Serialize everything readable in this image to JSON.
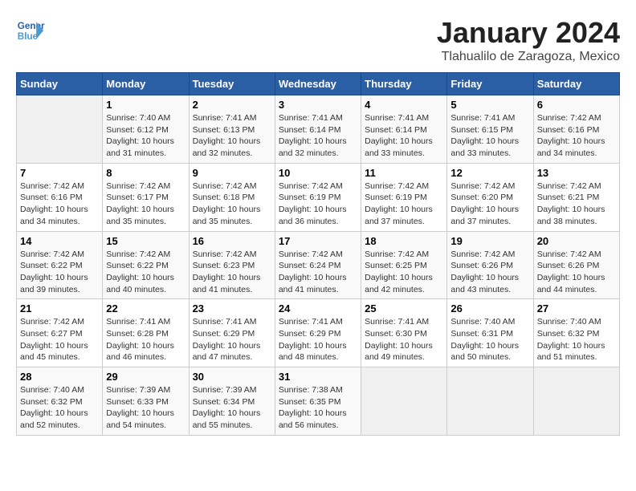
{
  "header": {
    "logo_line1": "General",
    "logo_line2": "Blue",
    "month_year": "January 2024",
    "location": "Tlahualilo de Zaragoza, Mexico"
  },
  "weekdays": [
    "Sunday",
    "Monday",
    "Tuesday",
    "Wednesday",
    "Thursday",
    "Friday",
    "Saturday"
  ],
  "weeks": [
    [
      {
        "day": "",
        "info": ""
      },
      {
        "day": "1",
        "info": "Sunrise: 7:40 AM\nSunset: 6:12 PM\nDaylight: 10 hours\nand 31 minutes."
      },
      {
        "day": "2",
        "info": "Sunrise: 7:41 AM\nSunset: 6:13 PM\nDaylight: 10 hours\nand 32 minutes."
      },
      {
        "day": "3",
        "info": "Sunrise: 7:41 AM\nSunset: 6:14 PM\nDaylight: 10 hours\nand 32 minutes."
      },
      {
        "day": "4",
        "info": "Sunrise: 7:41 AM\nSunset: 6:14 PM\nDaylight: 10 hours\nand 33 minutes."
      },
      {
        "day": "5",
        "info": "Sunrise: 7:41 AM\nSunset: 6:15 PM\nDaylight: 10 hours\nand 33 minutes."
      },
      {
        "day": "6",
        "info": "Sunrise: 7:42 AM\nSunset: 6:16 PM\nDaylight: 10 hours\nand 34 minutes."
      }
    ],
    [
      {
        "day": "7",
        "info": "Sunrise: 7:42 AM\nSunset: 6:16 PM\nDaylight: 10 hours\nand 34 minutes."
      },
      {
        "day": "8",
        "info": "Sunrise: 7:42 AM\nSunset: 6:17 PM\nDaylight: 10 hours\nand 35 minutes."
      },
      {
        "day": "9",
        "info": "Sunrise: 7:42 AM\nSunset: 6:18 PM\nDaylight: 10 hours\nand 35 minutes."
      },
      {
        "day": "10",
        "info": "Sunrise: 7:42 AM\nSunset: 6:19 PM\nDaylight: 10 hours\nand 36 minutes."
      },
      {
        "day": "11",
        "info": "Sunrise: 7:42 AM\nSunset: 6:19 PM\nDaylight: 10 hours\nand 37 minutes."
      },
      {
        "day": "12",
        "info": "Sunrise: 7:42 AM\nSunset: 6:20 PM\nDaylight: 10 hours\nand 37 minutes."
      },
      {
        "day": "13",
        "info": "Sunrise: 7:42 AM\nSunset: 6:21 PM\nDaylight: 10 hours\nand 38 minutes."
      }
    ],
    [
      {
        "day": "14",
        "info": "Sunrise: 7:42 AM\nSunset: 6:22 PM\nDaylight: 10 hours\nand 39 minutes."
      },
      {
        "day": "15",
        "info": "Sunrise: 7:42 AM\nSunset: 6:22 PM\nDaylight: 10 hours\nand 40 minutes."
      },
      {
        "day": "16",
        "info": "Sunrise: 7:42 AM\nSunset: 6:23 PM\nDaylight: 10 hours\nand 41 minutes."
      },
      {
        "day": "17",
        "info": "Sunrise: 7:42 AM\nSunset: 6:24 PM\nDaylight: 10 hours\nand 41 minutes."
      },
      {
        "day": "18",
        "info": "Sunrise: 7:42 AM\nSunset: 6:25 PM\nDaylight: 10 hours\nand 42 minutes."
      },
      {
        "day": "19",
        "info": "Sunrise: 7:42 AM\nSunset: 6:26 PM\nDaylight: 10 hours\nand 43 minutes."
      },
      {
        "day": "20",
        "info": "Sunrise: 7:42 AM\nSunset: 6:26 PM\nDaylight: 10 hours\nand 44 minutes."
      }
    ],
    [
      {
        "day": "21",
        "info": "Sunrise: 7:42 AM\nSunset: 6:27 PM\nDaylight: 10 hours\nand 45 minutes."
      },
      {
        "day": "22",
        "info": "Sunrise: 7:41 AM\nSunset: 6:28 PM\nDaylight: 10 hours\nand 46 minutes."
      },
      {
        "day": "23",
        "info": "Sunrise: 7:41 AM\nSunset: 6:29 PM\nDaylight: 10 hours\nand 47 minutes."
      },
      {
        "day": "24",
        "info": "Sunrise: 7:41 AM\nSunset: 6:29 PM\nDaylight: 10 hours\nand 48 minutes."
      },
      {
        "day": "25",
        "info": "Sunrise: 7:41 AM\nSunset: 6:30 PM\nDaylight: 10 hours\nand 49 minutes."
      },
      {
        "day": "26",
        "info": "Sunrise: 7:40 AM\nSunset: 6:31 PM\nDaylight: 10 hours\nand 50 minutes."
      },
      {
        "day": "27",
        "info": "Sunrise: 7:40 AM\nSunset: 6:32 PM\nDaylight: 10 hours\nand 51 minutes."
      }
    ],
    [
      {
        "day": "28",
        "info": "Sunrise: 7:40 AM\nSunset: 6:32 PM\nDaylight: 10 hours\nand 52 minutes."
      },
      {
        "day": "29",
        "info": "Sunrise: 7:39 AM\nSunset: 6:33 PM\nDaylight: 10 hours\nand 54 minutes."
      },
      {
        "day": "30",
        "info": "Sunrise: 7:39 AM\nSunset: 6:34 PM\nDaylight: 10 hours\nand 55 minutes."
      },
      {
        "day": "31",
        "info": "Sunrise: 7:38 AM\nSunset: 6:35 PM\nDaylight: 10 hours\nand 56 minutes."
      },
      {
        "day": "",
        "info": ""
      },
      {
        "day": "",
        "info": ""
      },
      {
        "day": "",
        "info": ""
      }
    ]
  ]
}
